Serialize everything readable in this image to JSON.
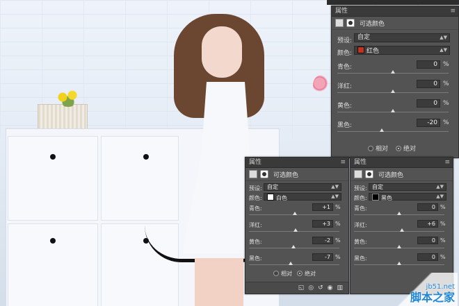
{
  "panels": [
    {
      "id": "main",
      "tab": "属性",
      "header": "可选颜色",
      "preset_label": "预设:",
      "preset_value": "自定",
      "color_label": "颜色:",
      "color_value": "红色",
      "color_hex": "#c0341f",
      "channels": [
        {
          "label": "青色:",
          "value": "0",
          "unit": "%",
          "thumb": 0.5
        },
        {
          "label": "洋红:",
          "value": "0",
          "unit": "%",
          "thumb": 0.5
        },
        {
          "label": "黄色:",
          "value": "0",
          "unit": "%",
          "thumb": 0.5
        },
        {
          "label": "黑色:",
          "value": "-20",
          "unit": "%",
          "thumb": 0.4
        }
      ],
      "radio_relative": "相对",
      "radio_absolute": "绝对",
      "selected_method": "absolute"
    },
    {
      "id": "white",
      "tab": "属性",
      "header": "可选颜色",
      "preset_label": "预设:",
      "preset_value": "自定",
      "color_label": "颜色:",
      "color_value": "白色",
      "color_hex": "#ffffff",
      "channels": [
        {
          "label": "青色:",
          "value": "+1",
          "unit": "%",
          "thumb": 0.505
        },
        {
          "label": "洋红:",
          "value": "+3",
          "unit": "%",
          "thumb": 0.515
        },
        {
          "label": "黄色:",
          "value": "-2",
          "unit": "%",
          "thumb": 0.49
        },
        {
          "label": "黑色:",
          "value": "-7",
          "unit": "%",
          "thumb": 0.465
        }
      ],
      "radio_relative": "相对",
      "radio_absolute": "绝对",
      "selected_method": "absolute"
    },
    {
      "id": "black",
      "tab": "属性",
      "header": "可选颜色",
      "preset_label": "预设:",
      "preset_value": "自定",
      "color_label": "颜色:",
      "color_value": "黑色",
      "color_hex": "#000000",
      "channels": [
        {
          "label": "青色:",
          "value": "0",
          "unit": "%",
          "thumb": 0.5
        },
        {
          "label": "洋红:",
          "value": "+6",
          "unit": "%",
          "thumb": 0.53
        },
        {
          "label": "黄色:",
          "value": "0",
          "unit": "%",
          "thumb": 0.5
        },
        {
          "label": "黑色:",
          "value": "0",
          "unit": "%",
          "thumb": 0.5
        }
      ]
    }
  ],
  "watermark": {
    "site": "jb51.net",
    "name": "脚本之家"
  },
  "colors": {
    "panel_bg": "#535353",
    "title_bg": "#3a3a3a",
    "watermark": "#1f86d8"
  }
}
